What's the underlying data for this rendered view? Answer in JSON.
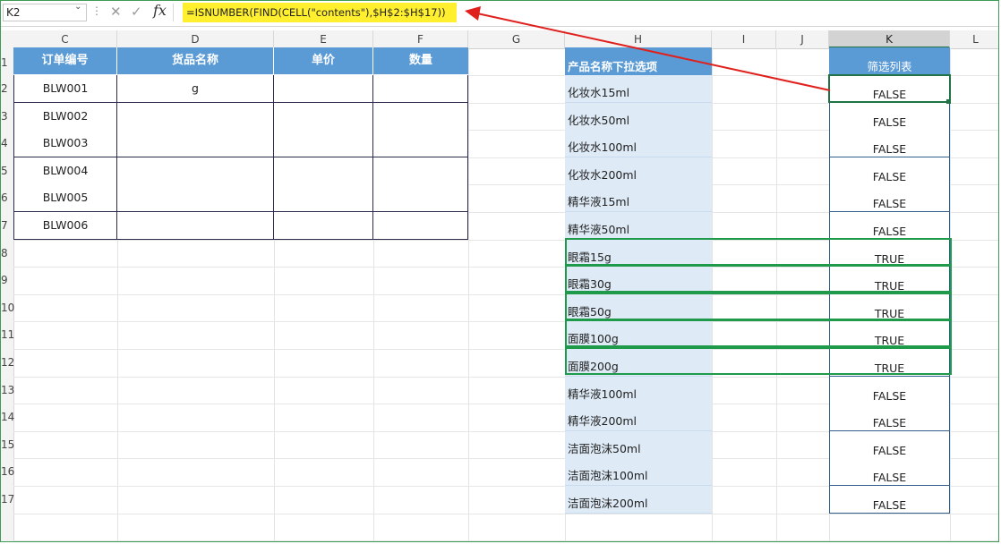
{
  "formula_bar": {
    "name_box": "K2",
    "fx_label": "fx",
    "formula": "=ISNUMBER(FIND(CELL(\"contents\"),$H$2:$H$17))"
  },
  "columns": [
    "C",
    "D",
    "E",
    "F",
    "G",
    "H",
    "I",
    "J",
    "K",
    "L"
  ],
  "row_numbers": [
    "1",
    "2",
    "3",
    "4",
    "5",
    "6",
    "7",
    "8",
    "9",
    "10",
    "11",
    "12",
    "13",
    "14",
    "15",
    "16",
    "17"
  ],
  "order_table": {
    "headers": [
      "订单编号",
      "货品名称",
      "单价",
      "数量"
    ],
    "rows": [
      [
        "BLW001",
        "g",
        "",
        ""
      ],
      [
        "BLW002",
        "",
        "",
        ""
      ],
      [
        "BLW003",
        "",
        "",
        ""
      ],
      [
        "BLW004",
        "",
        "",
        ""
      ],
      [
        "BLW005",
        "",
        "",
        ""
      ],
      [
        "BLW006",
        "",
        "",
        ""
      ]
    ]
  },
  "product_list": {
    "header": "产品名称下拉选项",
    "items": [
      "化妆水15ml",
      "化妆水50ml",
      "化妆水100ml",
      "化妆水200ml",
      "精华液15ml",
      "精华液50ml",
      "眼霜15g",
      "眼霜30g",
      "眼霜50g",
      "面膜100g",
      "面膜200g",
      "精华液100ml",
      "精华液200ml",
      "洁面泡沫50ml",
      "洁面泡沫100ml",
      "洁面泡沫200ml"
    ]
  },
  "filter_column": {
    "header": "筛选列表",
    "values": [
      "FALSE",
      "FALSE",
      "FALSE",
      "FALSE",
      "FALSE",
      "FALSE",
      "TRUE",
      "TRUE",
      "TRUE",
      "TRUE",
      "TRUE",
      "FALSE",
      "FALSE",
      "FALSE",
      "FALSE",
      "FALSE"
    ]
  },
  "colors": {
    "header_blue": "#5b9bd5",
    "list_fill": "#deeaf6",
    "highlight_green": "#1e9a4a",
    "arrow_red": "#e0201c",
    "formula_highlight": "#ffef2e"
  }
}
